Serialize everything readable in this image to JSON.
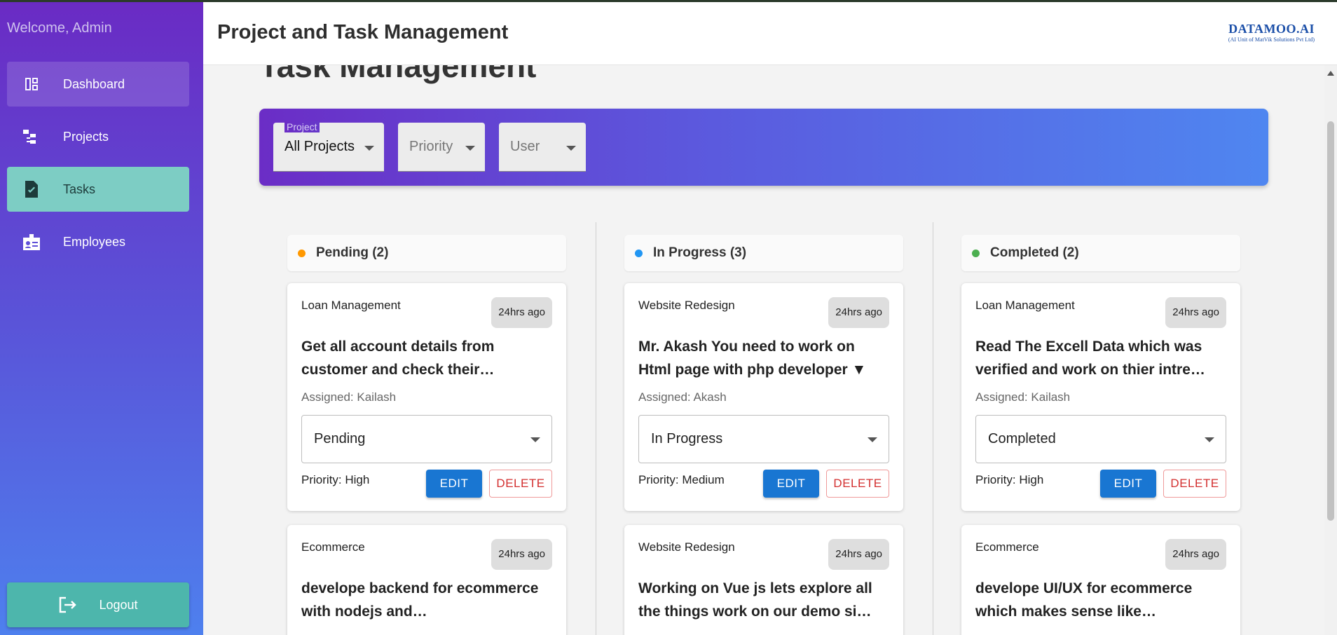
{
  "sidebar": {
    "welcome": "Welcome, Admin",
    "items": [
      {
        "label": "Dashboard",
        "icon": "dashboard-icon"
      },
      {
        "label": "Projects",
        "icon": "hierarchy-icon"
      },
      {
        "label": "Tasks",
        "icon": "task-icon"
      },
      {
        "label": "Employees",
        "icon": "badge-icon"
      }
    ],
    "logout_label": "Logout"
  },
  "header": {
    "title": "Project and Task Management",
    "logo_main": "DATAMOO.AI",
    "logo_sub": "(AI Unit of MatVik Solutions Pvt Ltd)"
  },
  "main": {
    "page_title": "Task Management",
    "filters": {
      "project_label": "Project",
      "project_value": "All Projects",
      "priority_value": "Priority",
      "user_value": "User"
    },
    "columns": [
      {
        "heading": "Pending (2)",
        "dot_color": "#ff9800",
        "cards": [
          {
            "project": "Loan Management",
            "time": "24hrs ago",
            "title": "Get all account details from customer and check their…",
            "assigned": "Assigned: Kailash",
            "status": "Pending",
            "priority": "Priority: High",
            "edit": "EDIT",
            "delete": "DELETE"
          },
          {
            "project": "Ecommerce",
            "time": "24hrs ago",
            "title": "develope backend for ecommerce with nodejs and…"
          }
        ]
      },
      {
        "heading": "In Progress (3)",
        "dot_color": "#2196f3",
        "cards": [
          {
            "project": "Website Redesign",
            "time": "24hrs ago",
            "title": "Mr. Akash You need to work on Html page with php developer ▼",
            "assigned": "Assigned: Akash",
            "status": "In Progress",
            "priority": "Priority: Medium",
            "edit": "EDIT",
            "delete": "DELETE"
          },
          {
            "project": "Website Redesign",
            "time": "24hrs ago",
            "title": "Working on Vue js lets explore all the things work on our demo si…"
          }
        ]
      },
      {
        "heading": "Completed (2)",
        "dot_color": "#4caf50",
        "cards": [
          {
            "project": "Loan Management",
            "time": "24hrs ago",
            "title": "Read The Excell Data which was verified and work on thier intre…",
            "assigned": "Assigned: Kailash",
            "status": "Completed",
            "priority": "Priority: High",
            "edit": "EDIT",
            "delete": "DELETE"
          },
          {
            "project": "Ecommerce",
            "time": "24hrs ago",
            "title": "develope UI/UX for ecommerce which makes sense like…"
          }
        ]
      }
    ]
  }
}
